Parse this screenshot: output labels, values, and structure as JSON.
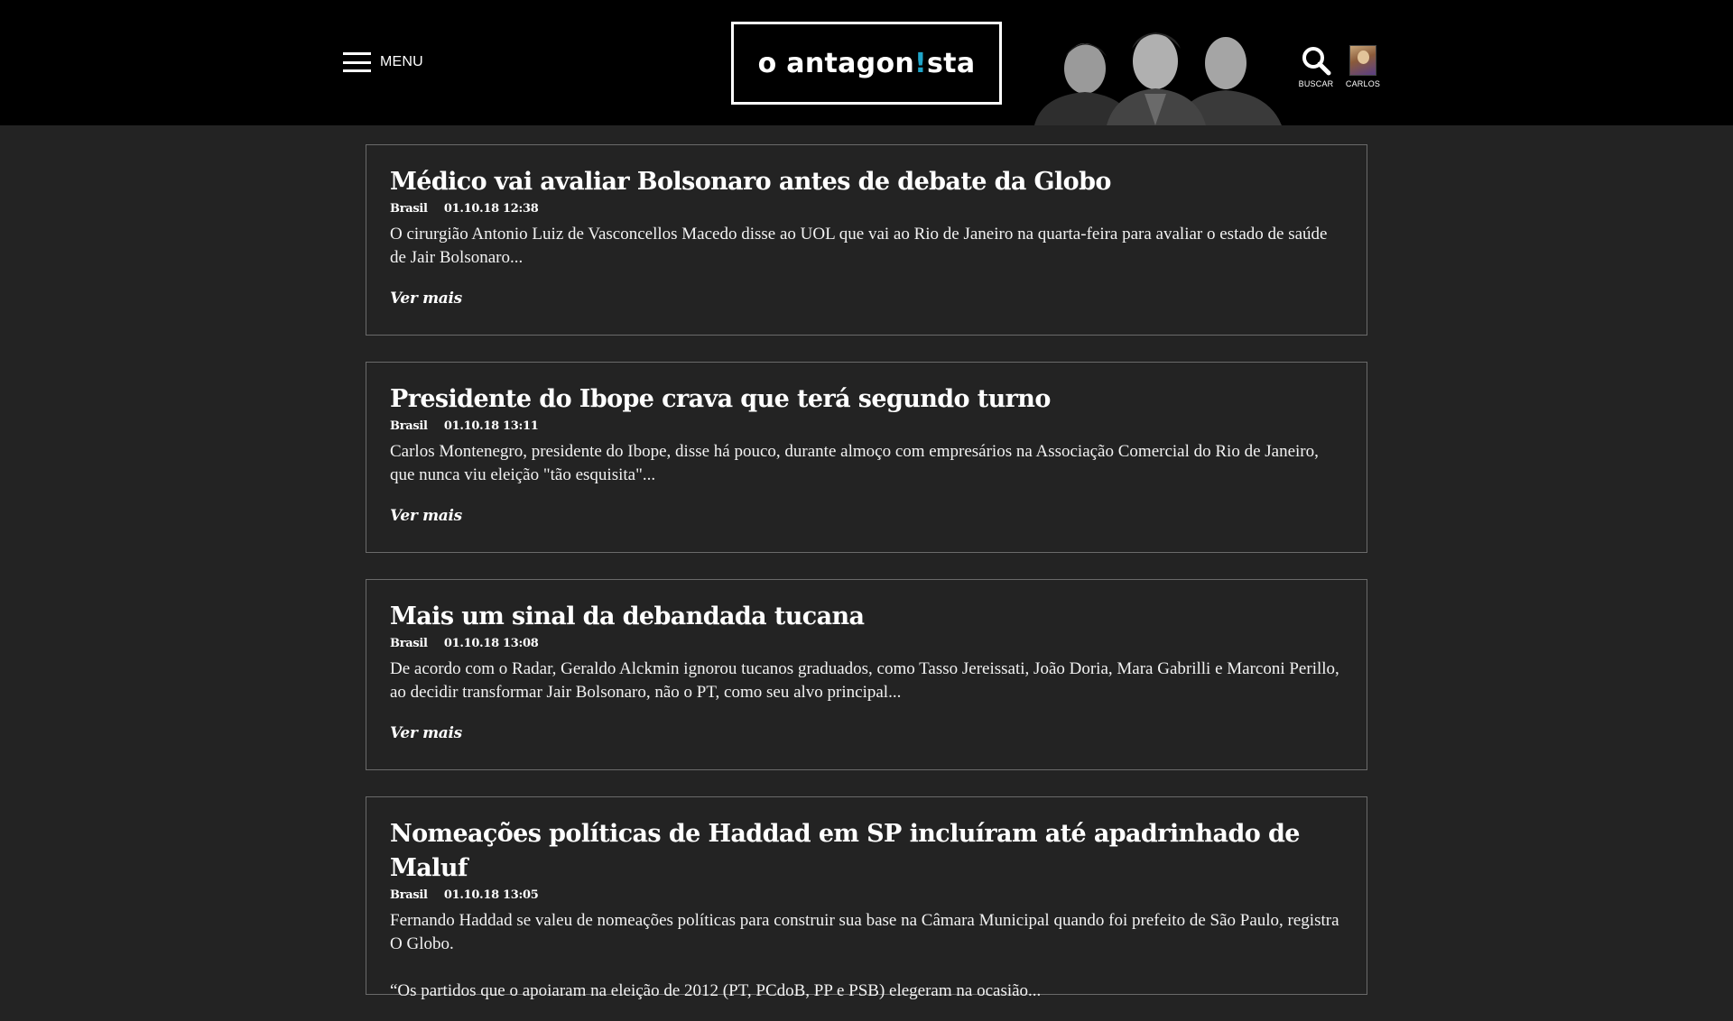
{
  "header": {
    "menu_label": "MENU",
    "logo": {
      "part1": "o antagon",
      "bang": "!",
      "part2": "sta"
    },
    "search_label": "BUSCAR",
    "user_label": "CARLOS"
  },
  "colors": {
    "background": "#232323",
    "header_background": "#000000",
    "accent": "#1fa5c9",
    "card_border": "#6a6a6a"
  },
  "articles": [
    {
      "title": "Médico vai avaliar Bolsonaro antes de debate da Globo",
      "category": "Brasil",
      "datetime": "01.10.18 12:38",
      "excerpt": "O cirurgião Antonio Luiz de Vasconcellos Macedo disse ao UOL que vai ao Rio de Janeiro na quarta-feira para avaliar o estado de saúde de Jair Bolsonaro...",
      "more": "Ver mais"
    },
    {
      "title": "Presidente do Ibope crava que terá segundo turno",
      "category": "Brasil",
      "datetime": "01.10.18 13:11",
      "excerpt": "Carlos Montenegro, presidente do Ibope, disse há pouco, durante almoço com empresários na Associação Comercial do Rio de Janeiro, que nunca viu eleição \"tão esquisita\"...",
      "more": "Ver mais"
    },
    {
      "title": "Mais um sinal da debandada tucana",
      "category": "Brasil",
      "datetime": "01.10.18 13:08",
      "excerpt": "De acordo com o Radar, Geraldo Alckmin ignorou tucanos graduados, como Tasso Jereissati, João Doria, Mara Gabrilli e Marconi Perillo, ao decidir transformar Jair Bolsonaro, não o PT, como seu alvo principal...",
      "more": "Ver mais"
    },
    {
      "title": "Nomeações políticas de Haddad em SP incluíram até apadrinhado de Maluf",
      "category": "Brasil",
      "datetime": "01.10.18 13:05",
      "excerpt": "Fernando Haddad se valeu de nomeações políticas para construir sua base na Câmara Municipal quando foi prefeito de São Paulo, registra O Globo.",
      "excerpt2": "“Os partidos que o apoiaram na eleição de 2012 (PT, PCdoB, PP e PSB) elegeram na ocasião..."
    }
  ]
}
